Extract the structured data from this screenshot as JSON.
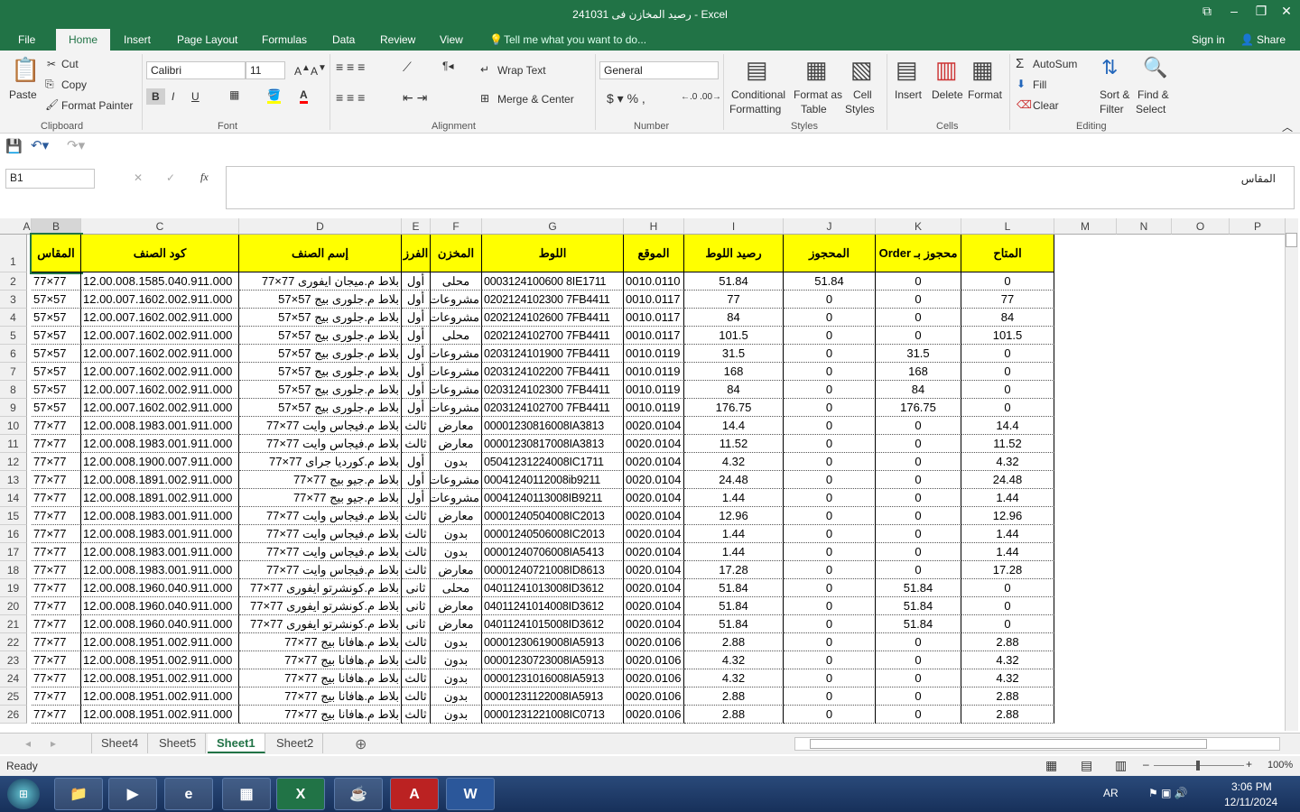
{
  "title": "رصيد المخازن فى 241031 - Excel",
  "window_controls": {
    "restore_ribbon": "⧉",
    "minimize": "–",
    "maximize": "❐",
    "close": "✕"
  },
  "tabs": [
    "File",
    "Home",
    "Insert",
    "Page Layout",
    "Formulas",
    "Data",
    "Review",
    "View"
  ],
  "tell_me": "Tell me what you want to do...",
  "sign_in": "Sign in",
  "share": "Share",
  "ribbon": {
    "clipboard": {
      "paste": "Paste",
      "cut": "Cut",
      "copy": "Copy",
      "format_painter": "Format Painter",
      "label": "Clipboard"
    },
    "font": {
      "name": "Calibri",
      "size": "11",
      "bold": "B",
      "italic": "I",
      "underline": "U",
      "label": "Font"
    },
    "alignment": {
      "wrap": "Wrap Text",
      "merge": "Merge & Center",
      "label": "Alignment"
    },
    "number": {
      "format": "General",
      "label": "Number"
    },
    "styles": {
      "conditional": "Conditional",
      "formatting": "Formatting",
      "format_as": "Format as",
      "table": "Table",
      "cell": "Cell",
      "cell_styles": "Styles",
      "label": "Styles"
    },
    "cells": {
      "insert": "Insert",
      "delete": "Delete",
      "format": "Format",
      "label": "Cells"
    },
    "editing": {
      "autosum": "AutoSum",
      "fill": "Fill",
      "clear": "Clear",
      "sort": "Sort &",
      "filter": "Filter",
      "find": "Find &",
      "select": "Select",
      "label": "Editing"
    }
  },
  "name_box": "B1",
  "formula": "المقاس",
  "columns": [
    "A",
    "B",
    "C",
    "D",
    "E",
    "F",
    "G",
    "H",
    "I",
    "J",
    "K",
    "L",
    "M",
    "N",
    "O",
    "P"
  ],
  "headers": [
    "المقاس",
    "كود الصنف",
    "إسم الصنف",
    "الفرز",
    "المخزن",
    "اللوط",
    "الموقع",
    "رصيد اللوط",
    "المحجوز",
    "محجوز بـ Order",
    "المتاح"
  ],
  "rows": [
    [
      "77×77",
      "12.00.008.1585.040.911.000",
      "بلاط م.ميجان ايفورى 77×77",
      "أول",
      "محلى",
      "0003124100600 8IE1711",
      "0010.0110",
      "51.84",
      "51.84",
      "0",
      "0"
    ],
    [
      "57×57",
      "12.00.007.1602.002.911.000",
      "بلاط م.جلورى بيج 57×57",
      "أول",
      "مشروعات",
      "0202124102300 7FB4411",
      "0010.0117",
      "77",
      "0",
      "0",
      "77"
    ],
    [
      "57×57",
      "12.00.007.1602.002.911.000",
      "بلاط م.جلورى بيج 57×57",
      "أول",
      "مشروعات",
      "0202124102600 7FB4411",
      "0010.0117",
      "84",
      "0",
      "0",
      "84"
    ],
    [
      "57×57",
      "12.00.007.1602.002.911.000",
      "بلاط م.جلورى بيج 57×57",
      "أول",
      "محلى",
      "0202124102700 7FB4411",
      "0010.0117",
      "101.5",
      "0",
      "0",
      "101.5"
    ],
    [
      "57×57",
      "12.00.007.1602.002.911.000",
      "بلاط م.جلورى بيج 57×57",
      "أول",
      "مشروعات",
      "0203124101900 7FB4411",
      "0010.0119",
      "31.5",
      "0",
      "31.5",
      "0"
    ],
    [
      "57×57",
      "12.00.007.1602.002.911.000",
      "بلاط م.جلورى بيج 57×57",
      "أول",
      "مشروعات",
      "0203124102200 7FB4411",
      "0010.0119",
      "168",
      "0",
      "168",
      "0"
    ],
    [
      "57×57",
      "12.00.007.1602.002.911.000",
      "بلاط م.جلورى بيج 57×57",
      "أول",
      "مشروعات",
      "0203124102300 7FB4411",
      "0010.0119",
      "84",
      "0",
      "84",
      "0"
    ],
    [
      "57×57",
      "12.00.007.1602.002.911.000",
      "بلاط م.جلورى بيج 57×57",
      "أول",
      "مشروعات",
      "0203124102700 7FB4411",
      "0010.0119",
      "176.75",
      "0",
      "176.75",
      "0"
    ],
    [
      "77×77",
      "12.00.008.1983.001.911.000",
      "بلاط م.فيجاس وايت 77×77",
      "ثالث",
      "معارض",
      "00001230816008IA3813",
      "0020.0104",
      "14.4",
      "0",
      "0",
      "14.4"
    ],
    [
      "77×77",
      "12.00.008.1983.001.911.000",
      "بلاط م.فيجاس وايت 77×77",
      "ثالث",
      "معارض",
      "00001230817008IA3813",
      "0020.0104",
      "11.52",
      "0",
      "0",
      "11.52"
    ],
    [
      "77×77",
      "12.00.008.1900.007.911.000",
      "بلاط م.كورديا جراى 77×77",
      "أول",
      "بدون",
      "05041231224008IC1711",
      "0020.0104",
      "4.32",
      "0",
      "0",
      "4.32"
    ],
    [
      "77×77",
      "12.00.008.1891.002.911.000",
      "بلاط م.جيو بيج 77×77",
      "أول",
      "مشروعات",
      "00041240112008ib9211",
      "0020.0104",
      "24.48",
      "0",
      "0",
      "24.48"
    ],
    [
      "77×77",
      "12.00.008.1891.002.911.000",
      "بلاط م.جيو بيج 77×77",
      "أول",
      "مشروعات",
      "00041240113008IB9211",
      "0020.0104",
      "1.44",
      "0",
      "0",
      "1.44"
    ],
    [
      "77×77",
      "12.00.008.1983.001.911.000",
      "بلاط م.فيجاس وايت 77×77",
      "ثالث",
      "معارض",
      "00001240504008IC2013",
      "0020.0104",
      "12.96",
      "0",
      "0",
      "12.96"
    ],
    [
      "77×77",
      "12.00.008.1983.001.911.000",
      "بلاط م.فيجاس وايت 77×77",
      "ثالث",
      "بدون",
      "00001240506008IC2013",
      "0020.0104",
      "1.44",
      "0",
      "0",
      "1.44"
    ],
    [
      "77×77",
      "12.00.008.1983.001.911.000",
      "بلاط م.فيجاس وايت 77×77",
      "ثالث",
      "بدون",
      "00001240706008IA5413",
      "0020.0104",
      "1.44",
      "0",
      "0",
      "1.44"
    ],
    [
      "77×77",
      "12.00.008.1983.001.911.000",
      "بلاط م.فيجاس وايت 77×77",
      "ثالث",
      "معارض",
      "00001240721008ID8613",
      "0020.0104",
      "17.28",
      "0",
      "0",
      "17.28"
    ],
    [
      "77×77",
      "12.00.008.1960.040.911.000",
      "بلاط م.كونشرتو ايفورى 77×77",
      "ثانى",
      "محلى",
      "04011241013008ID3612",
      "0020.0104",
      "51.84",
      "0",
      "51.84",
      "0"
    ],
    [
      "77×77",
      "12.00.008.1960.040.911.000",
      "بلاط م.كونشرتو ايفورى 77×77",
      "ثانى",
      "معارض",
      "04011241014008ID3612",
      "0020.0104",
      "51.84",
      "0",
      "51.84",
      "0"
    ],
    [
      "77×77",
      "12.00.008.1960.040.911.000",
      "بلاط م.كونشرتو ايفورى 77×77",
      "ثانى",
      "معارض",
      "04011241015008ID3612",
      "0020.0104",
      "51.84",
      "0",
      "51.84",
      "0"
    ],
    [
      "77×77",
      "12.00.008.1951.002.911.000",
      "بلاط م.هافانا بيج 77×77",
      "ثالث",
      "بدون",
      "00001230619008IA5913",
      "0020.0106",
      "2.88",
      "0",
      "0",
      "2.88"
    ],
    [
      "77×77",
      "12.00.008.1951.002.911.000",
      "بلاط م.هافانا بيج 77×77",
      "ثالث",
      "بدون",
      "00001230723008IA5913",
      "0020.0106",
      "4.32",
      "0",
      "0",
      "4.32"
    ],
    [
      "77×77",
      "12.00.008.1951.002.911.000",
      "بلاط م.هافانا بيج 77×77",
      "ثالث",
      "بدون",
      "00001231016008IA5913",
      "0020.0106",
      "4.32",
      "0",
      "0",
      "4.32"
    ],
    [
      "77×77",
      "12.00.008.1951.002.911.000",
      "بلاط م.هافانا بيج 77×77",
      "ثالث",
      "بدون",
      "00001231122008IA5913",
      "0020.0106",
      "2.88",
      "0",
      "0",
      "2.88"
    ],
    [
      "77×77",
      "12.00.008.1951.002.911.000",
      "بلاط م.هافانا بيج 77×77",
      "ثالث",
      "بدون",
      "00001231221008IC0713",
      "0020.0106",
      "2.88",
      "0",
      "0",
      "2.88"
    ]
  ],
  "sheets": [
    "Sheet4",
    "Sheet5",
    "Sheet1",
    "Sheet2"
  ],
  "active_sheet": "Sheet1",
  "status": "Ready",
  "zoom": "100%",
  "tray": {
    "lang": "AR",
    "time": "3:06 PM",
    "date": "12/11/2024"
  },
  "colors": {
    "accent": "#217346",
    "header_fill": "#ffff00"
  }
}
